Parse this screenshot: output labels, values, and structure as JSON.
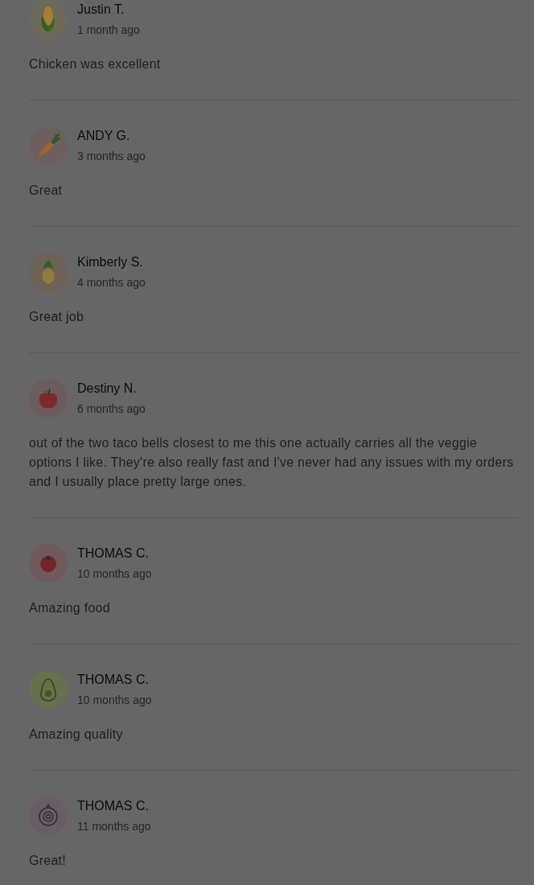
{
  "reviews": [
    {
      "name": "Justin T.",
      "time": "1 month ago",
      "text": "Chicken was excellent",
      "avatar": {
        "kind": "corn"
      }
    },
    {
      "name": "ANDY G.",
      "time": "3 months ago",
      "text": "Great",
      "avatar": {
        "kind": "carrot"
      }
    },
    {
      "name": "Kimberly S.",
      "time": "4 months ago",
      "text": "Great job",
      "avatar": {
        "kind": "pineapple"
      }
    },
    {
      "name": "Destiny N.",
      "time": "6 months ago",
      "text": "out of the two taco bells closest to me this one actually carries all the veggie options I like. They're also really fast and I've never had any issues with my orders and I usually place pretty large ones.",
      "avatar": {
        "kind": "apple"
      }
    },
    {
      "name": "THOMAS C.",
      "time": "10 months ago",
      "text": "Amazing food",
      "avatar": {
        "kind": "tomato"
      }
    },
    {
      "name": "THOMAS C.",
      "time": "10 months ago",
      "text": "Amazing quality",
      "avatar": {
        "kind": "avocado"
      }
    },
    {
      "name": "THOMAS C.",
      "time": "11 months ago",
      "text": "Great!",
      "avatar": {
        "kind": "onion"
      }
    }
  ]
}
